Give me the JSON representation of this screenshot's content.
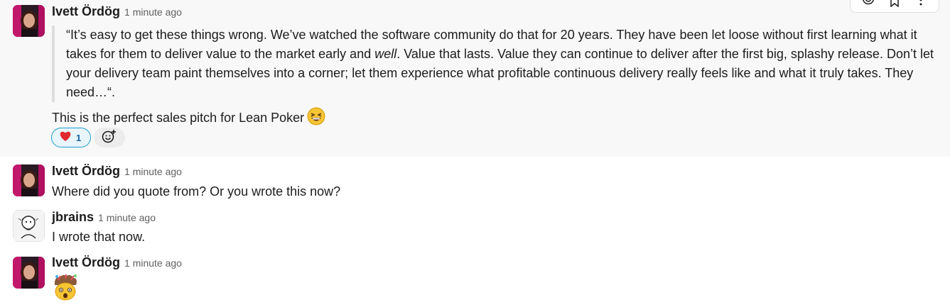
{
  "messages": [
    {
      "author": "Ivett Ördög",
      "time": "1 minute ago",
      "quote": {
        "part1": "“It’s easy to get these things wrong. We’ve watched the software community do that for 20 years. They have been let loose without first learning what it takes for them to deliver value to the market early and ",
        "emphasis": "well",
        "part2": ". Value that lasts. Value they can continue to deliver after the first big, splashy release. Don’t let your delivery team paint themselves into a corner; let them experience what profitable continuous delivery really feels like and what it truly takes. They need…“."
      },
      "text": "This is the perfect sales pitch for Lean Poker",
      "text_emoji": "grinning-squinting-face",
      "reactions": [
        {
          "emoji": "red-heart",
          "count": "1"
        }
      ],
      "add_reaction_icon": "add-reaction-icon"
    },
    {
      "author": "Ivett Ördög",
      "time": "1 minute ago",
      "text": "Where did you quote from? Or you wrote this now?"
    },
    {
      "author": "jbrains",
      "time": "1 minute ago",
      "text": "I wrote that now."
    },
    {
      "author": "Ivett Ördög",
      "time": "1 minute ago",
      "emoji": "exploding-head"
    }
  ],
  "toolbar": {
    "icons": [
      "emoji-reaction-icon",
      "bookmark-icon",
      "more-actions-icon"
    ]
  },
  "colors": {
    "hover_bg": "#f8f8f8",
    "quote_bar": "#dddddd",
    "reaction_border": "#1d9bd1",
    "reaction_bg": "#e8f5fa",
    "reaction_count": "#1264a3"
  }
}
